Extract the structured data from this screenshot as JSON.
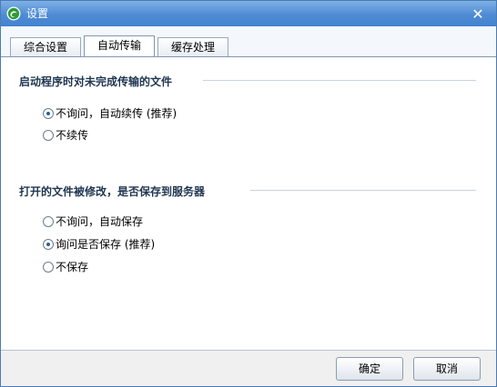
{
  "window": {
    "title": "设置",
    "icon": "app-logo-icon",
    "close_glyph": "✕"
  },
  "tabs": [
    {
      "label": "综合设置",
      "active": false
    },
    {
      "label": "自动传输",
      "active": true
    },
    {
      "label": "缓存处理",
      "active": false
    }
  ],
  "sections": [
    {
      "title": "启动程序时对未完成传输的文件",
      "options": [
        {
          "label": "不询问，自动续传 (推荐)",
          "checked": true
        },
        {
          "label": "不续传",
          "checked": false
        }
      ]
    },
    {
      "title": "打开的文件被修改，是否保存到服务器",
      "options": [
        {
          "label": "不询问，自动保存",
          "checked": false
        },
        {
          "label": "询问是否保存 (推荐)",
          "checked": true
        },
        {
          "label": "不保存",
          "checked": false
        }
      ]
    }
  ],
  "buttons": {
    "ok": "确定",
    "cancel": "取消"
  },
  "colors": {
    "titlebar": "#4f8bd4",
    "accent": "#2e5d9a"
  }
}
